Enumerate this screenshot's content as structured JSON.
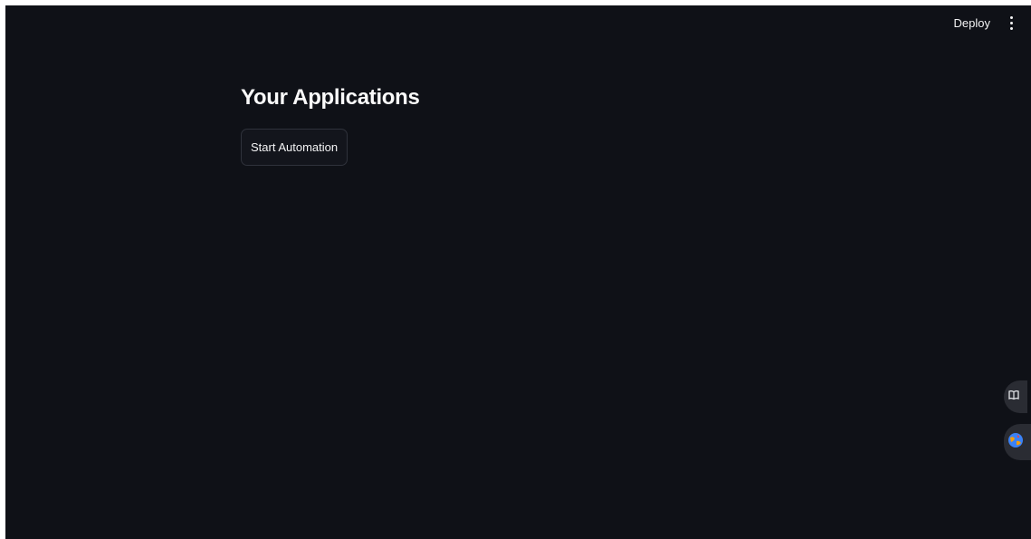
{
  "header": {
    "deploy_label": "Deploy",
    "menu_icon": "kebab-menu-icon"
  },
  "main": {
    "title": "Your Applications",
    "start_button_label": "Start Automation"
  },
  "floating": {
    "items": [
      {
        "icon": "book-icon"
      },
      {
        "icon": "globe-icon"
      }
    ]
  },
  "colors": {
    "background": "#0f1117",
    "text": "#fafafa",
    "button_border": "#2f323b",
    "floating_bg": "#2a2c33"
  }
}
